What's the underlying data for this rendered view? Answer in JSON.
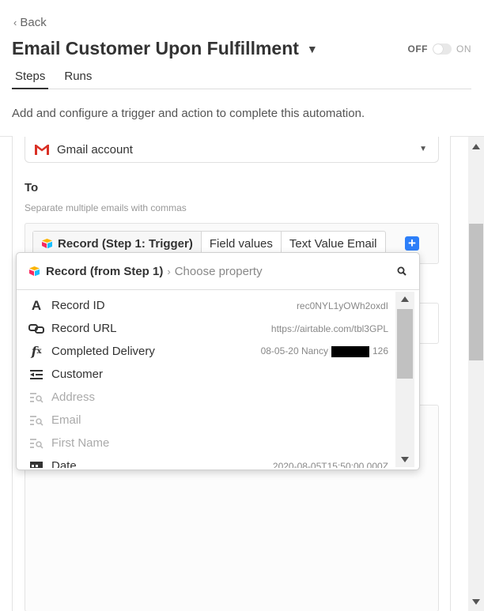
{
  "header": {
    "back_label": "Back",
    "title": "Email Customer Upon Fulfillment",
    "toggle_off": "OFF",
    "toggle_on": "ON"
  },
  "tabs": [
    {
      "label": "Steps",
      "active": true
    },
    {
      "label": "Runs",
      "active": false
    }
  ],
  "description": "Add and configure a trigger and action to complete this automation.",
  "account": {
    "label": "Gmail account"
  },
  "to": {
    "label": "To",
    "help": "Separate multiple emails with commas",
    "pills": [
      "Record (Step 1: Trigger)",
      "Field values",
      "Text Value Email"
    ]
  },
  "dropdown": {
    "record_label": "Record (from Step 1)",
    "separator": "›",
    "choose": "Choose property",
    "items": [
      {
        "icon": "text-field-icon",
        "label": "Record ID",
        "value": "rec0NYL1yOWh2oxdI",
        "disabled": false
      },
      {
        "icon": "link-icon",
        "label": "Record URL",
        "value": "https://airtable.com/tbl3GPL",
        "disabled": false
      },
      {
        "icon": "formula-icon",
        "label": "Completed Delivery",
        "value": "08-05-20 Nancy",
        "value_suffix": "126",
        "disabled": false
      },
      {
        "icon": "linked-record-icon",
        "label": "Customer",
        "value": "",
        "disabled": false
      },
      {
        "icon": "lookup-icon",
        "label": "Address",
        "value": "",
        "disabled": true
      },
      {
        "icon": "lookup-icon",
        "label": "Email",
        "value": "",
        "disabled": true
      },
      {
        "icon": "lookup-icon",
        "label": "First Name",
        "value": "",
        "disabled": true
      },
      {
        "icon": "calendar-icon",
        "label": "Date",
        "value": "2020-08-05T15:50:00.000Z",
        "disabled": false
      }
    ]
  },
  "colors": {
    "accent": "#2d7ff9",
    "gmail_red": "#d93025"
  }
}
